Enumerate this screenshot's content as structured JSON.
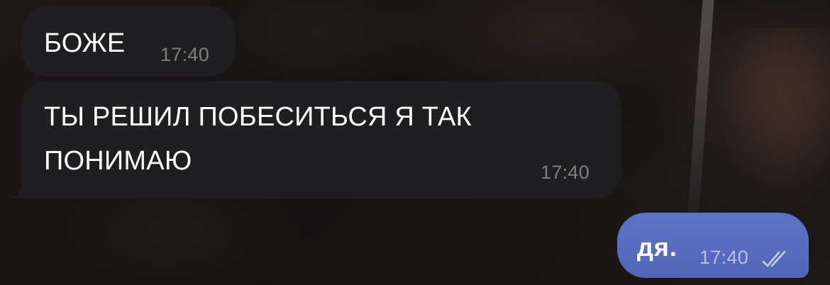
{
  "chat": {
    "messages": [
      {
        "direction": "incoming",
        "text": "БОЖЕ",
        "time": "17:40"
      },
      {
        "direction": "incoming",
        "text": "ТЫ РЕШИЛ ПОБЕСИТЬСЯ Я ТАК ПОНИМАЮ",
        "time": "17:40"
      },
      {
        "direction": "outgoing",
        "text": "дя.",
        "time": "17:40",
        "status_icon": "double-check-icon"
      }
    ]
  },
  "colors": {
    "incoming_bubble": "#1f1f21",
    "outgoing_bubble": "#5a6ec2",
    "text": "#ffffff",
    "timestamp_incoming": "#8a8a8c",
    "timestamp_outgoing": "#c9d0ee"
  }
}
